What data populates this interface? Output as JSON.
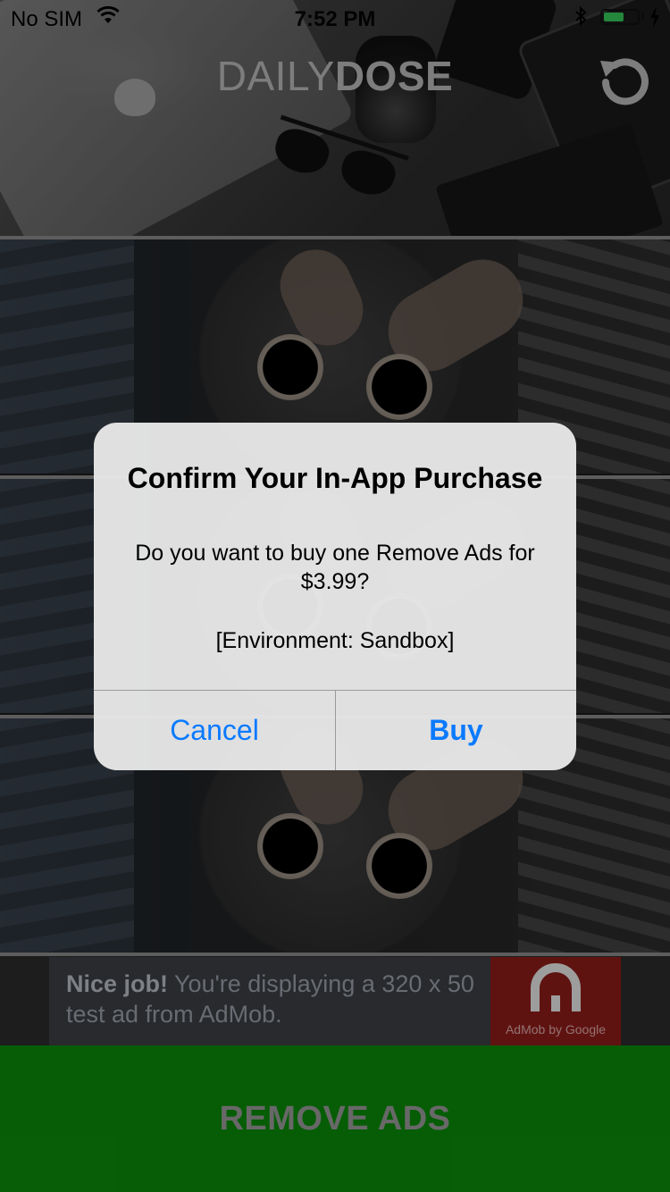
{
  "status_bar": {
    "carrier": "No SIM",
    "time": "7:52 PM",
    "battery_level": 0.6,
    "icons": [
      "wifi-icon",
      "bluetooth-icon",
      "battery-icon",
      "charging-bolt-icon"
    ]
  },
  "header": {
    "title_light": "DAILY",
    "title_bold": "DOSE",
    "refresh_icon": "refresh-icon"
  },
  "ad_banner": {
    "lead": "Nice job!",
    "body": " You're displaying a 320 x 50 test ad from AdMob.",
    "logo_caption": "AdMob by Google",
    "logo_icon": "admob-logo-icon"
  },
  "remove_ads": {
    "label": "REMOVE ADS"
  },
  "alert": {
    "title": "Confirm Your In-App Purchase",
    "message": "Do you want to buy one Remove Ads for $3.99?",
    "environment": "[Environment: Sandbox]",
    "cancel_label": "Cancel",
    "buy_label": "Buy"
  },
  "colors": {
    "ios_blue": "#0a7aff",
    "remove_ads_green": "#0a8a09",
    "admob_red": "#8c1d1a",
    "battery_green": "#34c759"
  }
}
